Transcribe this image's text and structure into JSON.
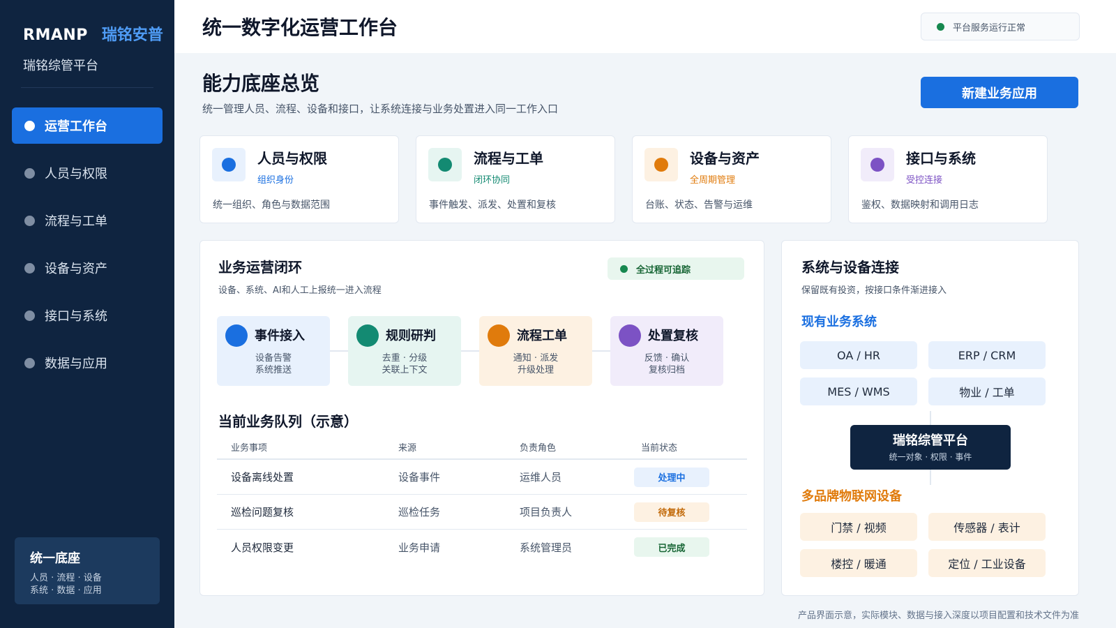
{
  "sidebar": {
    "brand_en": "RMANP",
    "brand_cn": "瑞铭安普",
    "subtitle": "瑞铭综管平台",
    "items": [
      {
        "label": "运营工作台",
        "active": true
      },
      {
        "label": "人员与权限"
      },
      {
        "label": "流程与工单"
      },
      {
        "label": "设备与资产"
      },
      {
        "label": "接口与系统"
      },
      {
        "label": "数据与应用"
      }
    ],
    "card": {
      "title": "统一底座",
      "line1": "人员 · 流程 · 设备",
      "line2": "系统 · 数据 · 应用"
    }
  },
  "header": {
    "title": "统一数字化运营工作台",
    "status": "平台服务运行正常"
  },
  "overview": {
    "title": "能力底座总览",
    "subtitle": "统一管理人员、流程、设备和接口，让系统连接与业务处置进入同一工作入口",
    "new_button": "新建业务应用",
    "cards": [
      {
        "title": "人员与权限",
        "tag": "组织身份",
        "desc": "统一组织、角色与数据范围",
        "color": "#1a6fe0",
        "bg": "#e8f1fd"
      },
      {
        "title": "流程与工单",
        "tag": "闭环协同",
        "desc": "事件触发、派发、处置和复核",
        "color": "#138a72",
        "bg": "#e6f5f1"
      },
      {
        "title": "设备与资产",
        "tag": "全周期管理",
        "desc": "台账、状态、告警与运维",
        "color": "#e07b0c",
        "bg": "#fdf1e2"
      },
      {
        "title": "接口与系统",
        "tag": "受控连接",
        "desc": "鉴权、数据映射和调用日志",
        "color": "#7c52c4",
        "bg": "#f1ecfa"
      }
    ]
  },
  "loop": {
    "title": "业务运营闭环",
    "subtitle": "设备、系统、AI和人工上报统一进入流程",
    "badge": "全过程可追踪",
    "steps": [
      {
        "title": "事件接入",
        "line1": "设备告警",
        "line2": "系统推送",
        "color": "#1a6fe0",
        "bg": "#e8f1fd"
      },
      {
        "title": "规则研判",
        "line1": "去重 · 分级",
        "line2": "关联上下文",
        "color": "#138a72",
        "bg": "#e6f5f1"
      },
      {
        "title": "流程工单",
        "line1": "通知 · 派发",
        "line2": "升级处理",
        "color": "#e07b0c",
        "bg": "#fdf1e2"
      },
      {
        "title": "处置复核",
        "line1": "反馈 · 确认",
        "line2": "复核归档",
        "color": "#7c52c4",
        "bg": "#f1ecfa"
      }
    ]
  },
  "queue": {
    "title": "当前业务队列（示意）",
    "columns": [
      "业务事项",
      "来源",
      "负责角色",
      "当前状态"
    ],
    "rows": [
      {
        "item": "设备离线处置",
        "source": "设备事件",
        "role": "运维人员",
        "status": "处理中",
        "color": "#1a6fe0",
        "bg": "#e8f1fd"
      },
      {
        "item": "巡检问题复核",
        "source": "巡检任务",
        "role": "项目负责人",
        "status": "待复核",
        "color": "#c26a0a",
        "bg": "#fdf1e2"
      },
      {
        "item": "人员权限变更",
        "source": "业务申请",
        "role": "系统管理员",
        "status": "已完成",
        "color": "#166534",
        "bg": "#e8f6ee"
      }
    ]
  },
  "connect": {
    "title": "系统与设备连接",
    "subtitle": "保留既有投资，按接口条件渐进接入",
    "existing_title": "现有业务系统",
    "existing": [
      "OA / HR",
      "ERP / CRM",
      "MES / WMS",
      "物业 / 工单"
    ],
    "hub_title": "瑞铭综管平台",
    "hub_sub": "统一对象 · 权限 · 事件",
    "iot_title": "多品牌物联网设备",
    "iot": [
      "门禁 / 视频",
      "传感器 / 表计",
      "楼控 / 暖通",
      "定位 / 工业设备"
    ],
    "colors": {
      "blue": "#1a6fe0",
      "orange": "#e07b0c",
      "chip_blue": "#e8f1fd",
      "chip_orange": "#fdf1e2"
    }
  },
  "footnote": "产品界面示意，实际模块、数据与接入深度以项目配置和技术文件为准"
}
